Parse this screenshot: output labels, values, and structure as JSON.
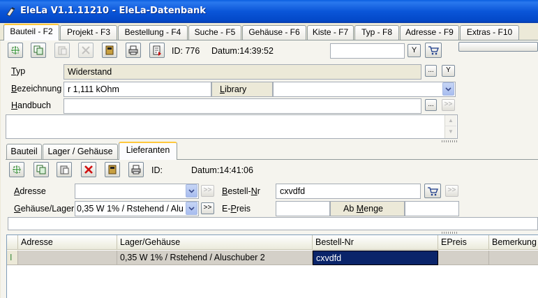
{
  "window": {
    "title": "EleLa V1.1.11210  - EleLa-Datenbank"
  },
  "main_tabs": [
    {
      "label": "Bauteil - F2",
      "active": true
    },
    {
      "label": "Projekt - F3"
    },
    {
      "label": "Bestellung - F4"
    },
    {
      "label": "Suche - F5"
    },
    {
      "label": "Gehäuse - F6"
    },
    {
      "label": "Kiste - F7"
    },
    {
      "label": "Typ - F8"
    },
    {
      "label": "Adresse - F9"
    },
    {
      "label": "Extras - F10"
    }
  ],
  "toolbar": {
    "id_text": "ID: 776",
    "datum_text": "Datum:14:39:52",
    "filter_btn": "Y"
  },
  "bauteil": {
    "typ_label": "Typ",
    "typ_value": "Widerstand",
    "bezeichnung_label": "Bezeichnung",
    "bezeichnung_value": "r 1,111 kOhm",
    "library_label": "Library",
    "library_value": "",
    "handbuch_label": "Handbuch",
    "handbuch_value": "",
    "dots_btn": "...",
    "next_btn": ">>",
    "filter_btn": "Y"
  },
  "sub_tabs": [
    {
      "label": "Bauteil"
    },
    {
      "label": "Lager / Gehäuse"
    },
    {
      "label": "Lieferanten",
      "active": true
    }
  ],
  "lieferanten": {
    "id_text": "ID:",
    "datum_text": "Datum:14:41:06",
    "adresse_label": "Adresse",
    "adresse_value": "",
    "gehaeuse_label": "Gehäuse/Lager",
    "gehaeuse_value": "0,35 W 1% / Rstehend / Alu",
    "bestell_label": "Bestell-Nr",
    "bestell_value": "cxvdfd",
    "epreis_label": "E-Preis",
    "epreis_value": "",
    "abmenge_label": "Ab Menge",
    "abmenge_value": "",
    "next_btn": ">>"
  },
  "grid": {
    "columns": [
      "Adresse",
      "Lager/Gehäuse",
      "Bestell-Nr",
      "EPreis",
      "Bemerkung"
    ],
    "rows": [
      {
        "marker": "I",
        "adresse": "",
        "lager": "0,35 W 1% / Rstehend / Aluschuber 2",
        "bestell": "cxvdfd",
        "epreis": "",
        "bemerkung": ""
      }
    ]
  }
}
